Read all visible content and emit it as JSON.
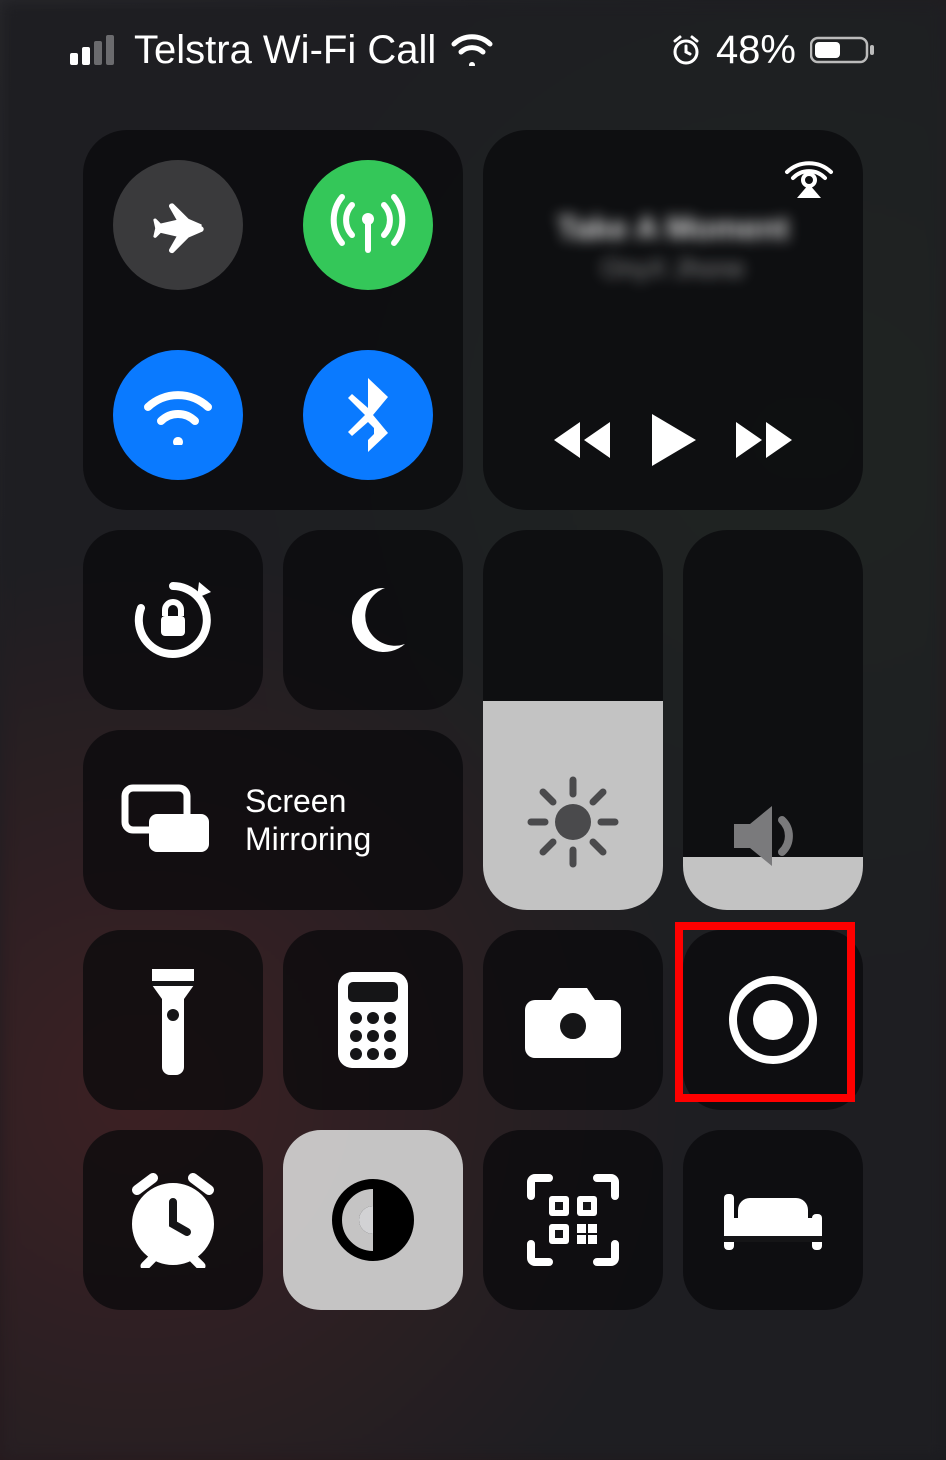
{
  "status": {
    "carrier": "Telstra Wi-Fi Call",
    "battery_text": "48%",
    "battery_level": 48,
    "signal_bars": 2
  },
  "connectivity": {
    "airplane": {
      "name": "airplane-mode",
      "enabled": false
    },
    "cellular": {
      "name": "cellular-data",
      "enabled": true
    },
    "wifi": {
      "name": "wifi",
      "enabled": true
    },
    "bluetooth": {
      "name": "bluetooth",
      "enabled": true
    }
  },
  "media": {
    "track": "Take A Moment",
    "artist": "OnyX Jhone",
    "playing": false
  },
  "sliders": {
    "brightness_percent": 55,
    "volume_percent": 14
  },
  "tiles": {
    "orientation_lock": "Orientation Lock",
    "do_not_disturb": "Do Not Disturb",
    "screen_mirroring_line1": "Screen",
    "screen_mirroring_line2": "Mirroring",
    "flashlight": "Flashlight",
    "calculator": "Calculator",
    "camera": "Camera",
    "screen_record": "Screen Recording",
    "alarm": "Alarm",
    "dark_mode": "Dark Mode",
    "qr_scanner": "Code Scanner",
    "sleep": "Sleep"
  },
  "highlight": {
    "target": "screen-record-button"
  }
}
